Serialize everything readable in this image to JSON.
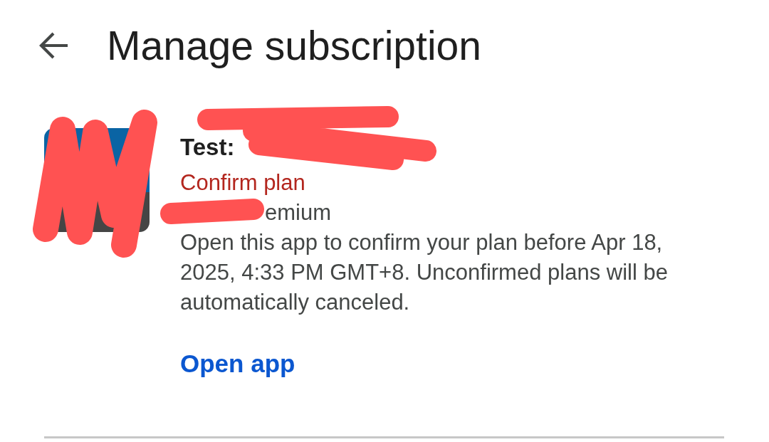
{
  "header": {
    "title": "Manage subscription"
  },
  "subscription": {
    "name": "Test:",
    "status": "Confirm plan",
    "plan": "emium",
    "message": "Open this app to confirm your plan before Apr 18, 2025, 4:33 PM GMT+8. Unconfirmed plans will be automatically canceled.",
    "action": "Open app"
  }
}
